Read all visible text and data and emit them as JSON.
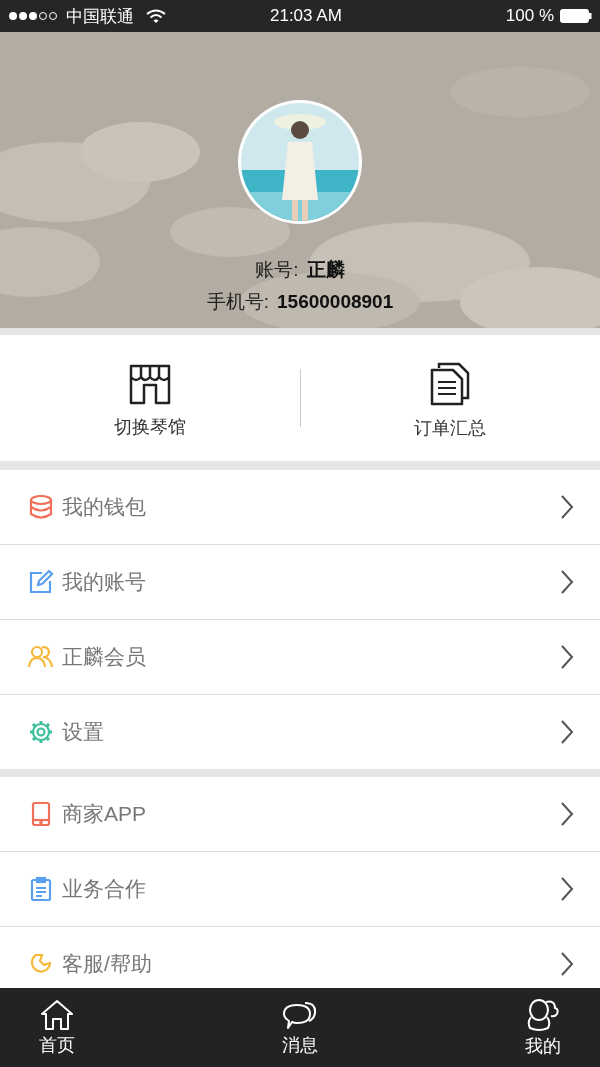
{
  "status_bar": {
    "carrier": "中国联通",
    "time": "21:03 AM",
    "battery": "100 %"
  },
  "profile": {
    "account_label": "账号:",
    "account": "正麟",
    "phone_label": "手机号:",
    "phone": "15600008901"
  },
  "shortcuts": [
    {
      "label": "切换琴馆"
    },
    {
      "label": "订单汇总"
    }
  ],
  "menu_groups": [
    [
      {
        "label": "我的钱包",
        "color": "#f0705a"
      },
      {
        "label": "我的账号",
        "color": "#5aa0f0"
      },
      {
        "label": "正麟会员",
        "color": "#f5b83a"
      },
      {
        "label": "设置",
        "color": "#3cbf9a"
      }
    ],
    [
      {
        "label": "商家APP",
        "color": "#f0705a"
      },
      {
        "label": "业务合作",
        "color": "#5aa0f0"
      },
      {
        "label": "客服/帮助",
        "color": "#f5b83a"
      }
    ]
  ],
  "tab_bar": [
    {
      "label": "首页"
    },
    {
      "label": "消息"
    },
    {
      "label": "我的"
    }
  ]
}
